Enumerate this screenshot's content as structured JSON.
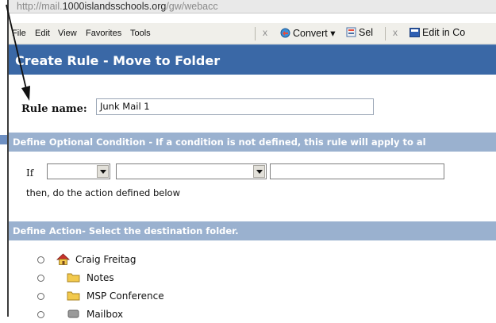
{
  "address_bar": {
    "prefix": "http://mail.",
    "domain": "1000islandsschools.org",
    "path": "/gw/webacc"
  },
  "menu": {
    "items": [
      "File",
      "Edit",
      "View",
      "Favorites",
      "Tools"
    ]
  },
  "toolbar": {
    "close_symbol": "x",
    "convert_label": "Convert",
    "convert_caret": "▾",
    "select_label": "Sel",
    "edit_label": "Edit in Co"
  },
  "dialog": {
    "title": "Create Rule - Move to Folder",
    "rule_name_label": "Rule name:",
    "rule_name_value": "Junk Mail 1",
    "condition_header": "Define Optional Condition - If a condition is not defined, this rule will apply to al",
    "if_label": "If",
    "then_text": "then, do the action defined below",
    "action_header": "Define Action- Select the destination folder."
  },
  "folders": [
    {
      "label": "Craig Freitag",
      "icon": "home-icon"
    },
    {
      "label": "Notes",
      "icon": "folder-icon"
    },
    {
      "label": "MSP Conference",
      "icon": "folder-icon"
    },
    {
      "label": "Mailbox",
      "icon": "mailbox-icon"
    }
  ],
  "colors": {
    "title_bar": "#3a68a6",
    "section_bar": "#9ab1cf",
    "folder": "#f2c94c"
  }
}
